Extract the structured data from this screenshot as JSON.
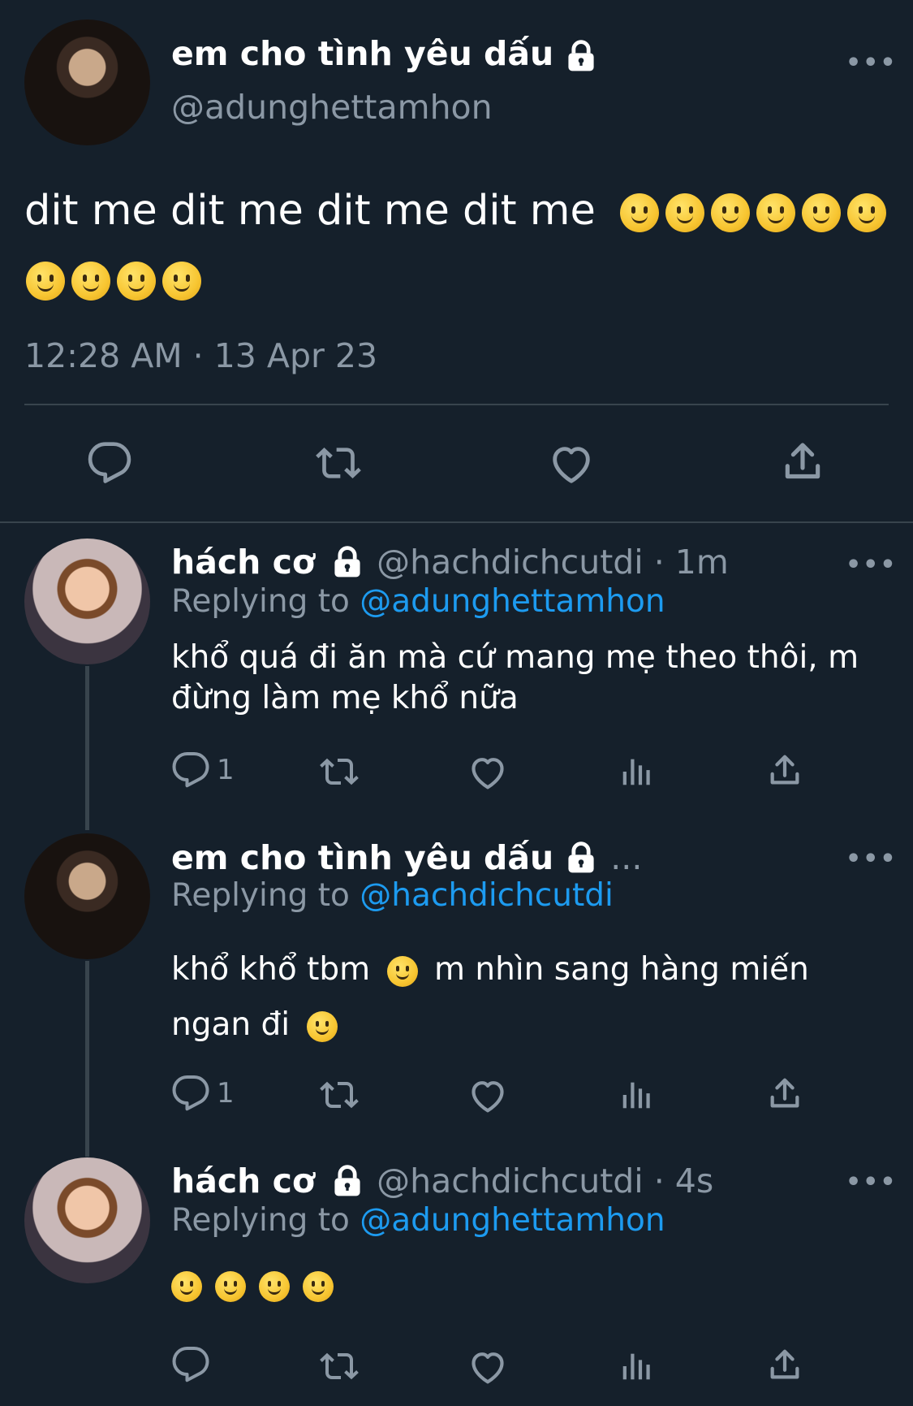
{
  "main_tweet": {
    "name": "em cho tình yêu dấu",
    "handle": "@adunghettamhon",
    "text": "dit me dit me dit me dit me",
    "timestamp": "12:28 AM · 13 Apr 23",
    "more": "•••"
  },
  "replies": [
    {
      "name": "hách cơ",
      "handle_time": "@hachdichcutdi · 1m",
      "replying_label": "Replying to",
      "replying_to": "@adunghettamhon",
      "text_line1": "khổ quá đi ăn mà cứ mang mẹ theo thôi, m",
      "text_line2": "đừng làm mẹ khổ nữa",
      "reply_count": "1",
      "more": "•••"
    },
    {
      "name": "em cho tình yêu dấu",
      "handle_time": "...",
      "replying_label": "Replying to",
      "replying_to": "@hachdichcutdi",
      "text_part1": "khổ khổ tbm",
      "text_part2": "m nhìn sang hàng miến",
      "text_part3": "ngan đi",
      "reply_count": "1",
      "more": "•••"
    },
    {
      "name": "hách cơ",
      "handle_time": "@hachdichcutdi · 4s",
      "replying_label": "Replying to",
      "replying_to": "@adunghettamhon",
      "more": "•••"
    }
  ],
  "icons": {
    "reply": "reply-icon",
    "retweet": "retweet-icon",
    "like": "heart-icon",
    "views": "views-icon",
    "share": "share-icon",
    "lock": "lock-icon",
    "emoji": "slightly-smiling-face-emoji"
  },
  "colors": {
    "background": "#15202b",
    "text": "#ffffff",
    "secondary": "#8b98a5",
    "link": "#1d9bf0",
    "divider": "#38444d"
  }
}
